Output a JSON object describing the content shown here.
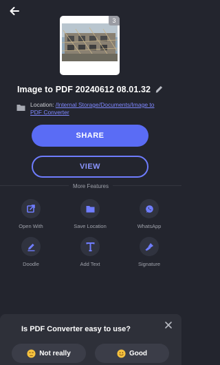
{
  "header": {
    "back_icon": "arrow-left-icon"
  },
  "thumbnail": {
    "page_count": "3",
    "image": "building-scaffold-photo"
  },
  "document": {
    "title": "Image to PDF 20240612 08.01.32",
    "location_label": "Location: ",
    "location_path": "/Internal Storage/Documents/Image to PDF Converter"
  },
  "actions": {
    "share_label": "SHARE",
    "view_label": "VIEW"
  },
  "more": {
    "title": "More Features",
    "items": [
      {
        "label": "Open With",
        "icon": "open-external-icon"
      },
      {
        "label": "Save Location",
        "icon": "folder-icon"
      },
      {
        "label": "WhatsApp",
        "icon": "whatsapp-icon"
      },
      {
        "label": "Doodle",
        "icon": "pencil-icon"
      },
      {
        "label": "Add Text",
        "icon": "text-icon"
      },
      {
        "label": "Signature",
        "icon": "pen-nib-icon"
      }
    ]
  },
  "feedback": {
    "question": "Is PDF Converter easy to use?",
    "negative_label": "Not really",
    "positive_label": "Good"
  },
  "colors": {
    "background": "#23252e",
    "accent": "#5a6cf5",
    "link": "#7f88ff",
    "sheet": "#2e3039"
  }
}
